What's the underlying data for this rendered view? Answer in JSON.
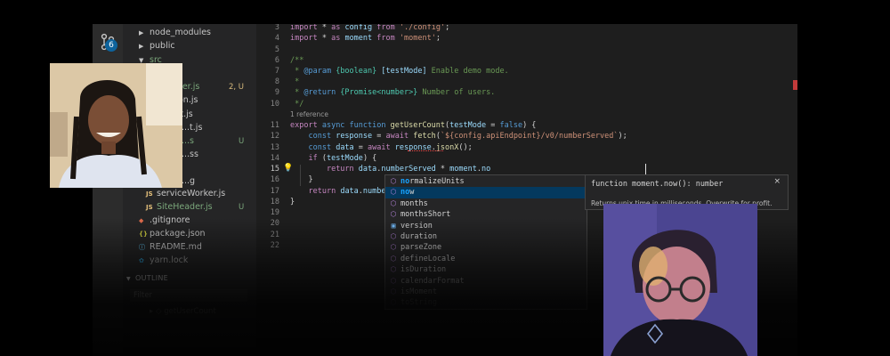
{
  "activity_bar": {
    "scm_badge": "6"
  },
  "explorer": {
    "items": [
      {
        "label": "node_modules",
        "kind": "folder"
      },
      {
        "label": "public",
        "kind": "folder"
      },
      {
        "label": "src",
        "kind": "folder-open"
      },
      {
        "label": "Header.js",
        "kind": "js"
      },
      {
        "label": "Button.js",
        "kind": "js"
      },
      {
        "label": "Chart.js",
        "kind": "js"
      },
      {
        "label": "...t.js",
        "kind": "js"
      },
      {
        "label": "...s",
        "kind": "js"
      },
      {
        "label": "...ss",
        "kind": "css"
      },
      {
        "label": "...g",
        "kind": "svg"
      },
      {
        "label": "serviceWorker.js",
        "kind": "js"
      },
      {
        "label": "SiteHeader.js",
        "kind": "js"
      },
      {
        "label": ".gitignore",
        "kind": "git"
      },
      {
        "label": "package.json",
        "kind": "json"
      },
      {
        "label": "README.md",
        "kind": "md"
      },
      {
        "label": "yarn.lock",
        "kind": "yarn"
      }
    ],
    "decorations": {
      "src_counts": "2, U",
      "untracked_a": "U",
      "untracked_b": "U"
    },
    "outline_label": "OUTLINE",
    "filter_placeholder": "Filter"
  },
  "editor": {
    "line_numbers": [
      "3",
      "4",
      "5",
      "6",
      "7",
      "8",
      "9",
      "10",
      "",
      "11",
      "12",
      "13",
      "14",
      "15",
      "16",
      "17",
      "18",
      "19",
      "20",
      "21",
      "22"
    ],
    "active_line": "15",
    "codelens": "1 reference",
    "code": {
      "l3": {
        "kw": "import",
        "rest1": " * ",
        "as": "as",
        "id": " config ",
        "from": "from",
        "str": " './config'",
        "end": ";"
      },
      "l4": {
        "kw": "import",
        "rest1": " * ",
        "as": "as",
        "id": " moment ",
        "from": "from",
        "str": " 'moment'",
        "end": ";"
      },
      "l6": "/**",
      "l7a": " * ",
      "l7b": "@param",
      "l7c": " {boolean} ",
      "l7d": "[testMode]",
      "l7e": " Enable demo mode.",
      "l8": " *",
      "l9a": " * ",
      "l9b": "@return",
      "l9c": " {Promise<number>} ",
      "l9d": "Number of users.",
      "l10": " */",
      "l11a": "export",
      "l11b": " async ",
      "l11c": "function",
      "l11d": " getUserCount",
      "l11e": "(",
      "l11f": "testMode",
      "l11g": " = ",
      "l11h": "false",
      "l11i": ") {",
      "l12a": "    ",
      "l12b": "const",
      "l12c": " response",
      "l12d": " = ",
      "l12e": "await",
      "l12f": " fetch",
      "l12g": "(",
      "l12h": "`${config.apiEndpoint}/v0/numberServed`",
      "l12i": ");",
      "l13a": "    ",
      "l13b": "const",
      "l13c": " data",
      "l13d": " = ",
      "l13e": "await",
      "l13f": " response",
      "l13g": ".",
      "l13h": "jsonX",
      "l13i": "();",
      "l14a": "    ",
      "l14b": "if",
      "l14c": " (",
      "l14d": "testMode",
      "l14e": ") {",
      "l15a": "        ",
      "l15b": "return",
      "l15c": " data",
      "l15d": ".",
      "l15e": "numberServed",
      "l15f": " * ",
      "l15g": "moment",
      "l15h": ".",
      "l15i": "no",
      "l16": "    }",
      "l17a": "    ",
      "l17b": "return",
      "l17c": " data",
      "l17d": ".",
      "l17e": "number",
      "l18": "}"
    }
  },
  "suggest": {
    "items": [
      {
        "pre": "",
        "match": "no",
        "post": "rmalizeUnits",
        "kind": "method"
      },
      {
        "pre": "",
        "match": "no",
        "post": "w",
        "kind": "method"
      },
      {
        "pre": "",
        "match": "",
        "post": "months",
        "kind": "method"
      },
      {
        "pre": "",
        "match": "",
        "post": "monthsShort",
        "kind": "method"
      },
      {
        "pre": "",
        "match": "",
        "post": "version",
        "kind": "variable"
      },
      {
        "pre": "",
        "match": "",
        "post": "duration",
        "kind": "method"
      },
      {
        "pre": "",
        "match": "",
        "post": "parseZone",
        "kind": "method"
      },
      {
        "pre": "",
        "match": "",
        "post": "defineLocale",
        "kind": "method"
      },
      {
        "pre": "",
        "match": "",
        "post": "isDuration",
        "kind": "method"
      },
      {
        "pre": "",
        "match": "",
        "post": "calendarFormat",
        "kind": "method"
      },
      {
        "pre": "",
        "match": "",
        "post": "isMoment",
        "kind": "method"
      },
      {
        "pre": "",
        "match": "",
        "post": "toString",
        "kind": "method"
      }
    ],
    "selected_index": 1,
    "detail_signature": "function moment.now(): number",
    "detail_close": "×",
    "detail_doc": "Returns unix time in milliseconds. Overwrite for profit."
  },
  "colors": {
    "accent": "#0e639c",
    "selected": "#04395e",
    "background": "#1e1e1e"
  }
}
